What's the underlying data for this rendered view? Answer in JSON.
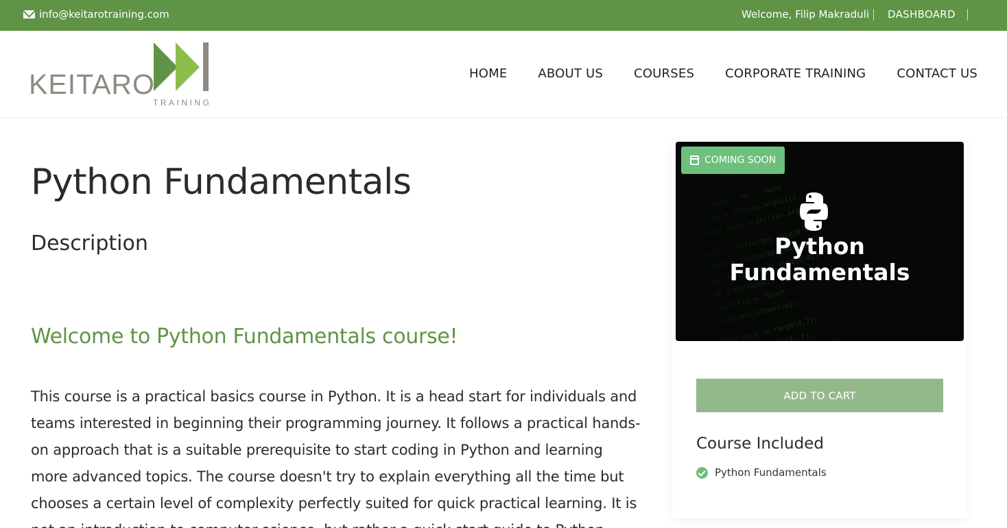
{
  "topbar": {
    "email": "info@keitarotraining.com",
    "welcome_text": "Welcome,  Filip Makraduli",
    "dashboard_label": "DASHBOARD"
  },
  "logo": {
    "brand": "KEITARO",
    "subtitle": "TRAINING"
  },
  "nav": {
    "items": [
      "HOME",
      "ABOUT US",
      "COURSES",
      "CORPORATE TRAINING",
      "CONTACT US"
    ]
  },
  "main": {
    "title": "Python Fundamentals",
    "description_heading": "Description",
    "welcome_heading": "Welcome to Python Fundamentals course!",
    "body": "This course is a practical basics course in Python. It is a head start for individuals and teams interested in beginning their programming journey. It follows a practical hands-on approach that is a suitable prerequisite to start coding in Python and learning more advanced topics. The course doesn't try to explain everything all the time but chooses a certain level of complexity perfectly suited for quick practical learning. It is not an introduction to computer science, but rather a quick start guide to Python."
  },
  "sidebar": {
    "badge": "COMING SOON",
    "thumb_title_line1": "Python",
    "thumb_title_line2": "Fundamentals",
    "add_to_cart": "ADD TO CART",
    "included_heading": "Course Included",
    "included_items": [
      "Python Fundamentals"
    ]
  },
  "colors": {
    "brand_green": "#5f9446",
    "logo_green_dark": "#5f9446",
    "logo_green_light": "#8cbd4c",
    "badge_green": "#6cc07c",
    "cart_button": "#93b98a"
  },
  "icons": {
    "email": "envelope-icon",
    "badge": "calendar-icon",
    "included": "check-circle-icon",
    "thumb": "python-logo-icon"
  }
}
